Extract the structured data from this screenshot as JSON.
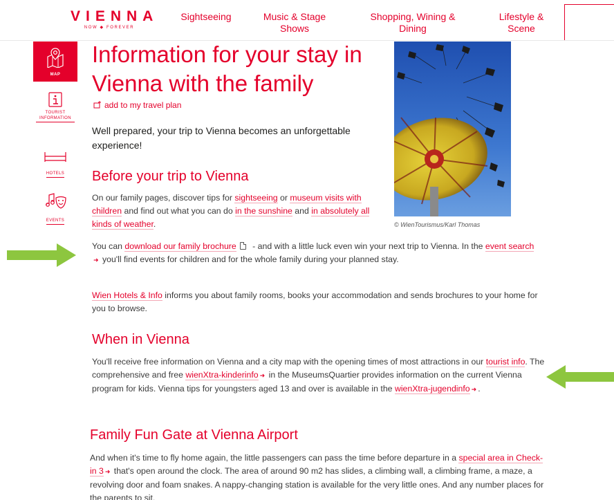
{
  "header": {
    "logo": {
      "word": "VIENNA",
      "sub": "NOW ◆ FOREVER"
    },
    "nav": [
      {
        "label": "Sightseeing"
      },
      {
        "label": "Music & Stage Shows"
      },
      {
        "label": "Shopping, Wining & Dining"
      },
      {
        "label": "Lifestyle & Scene"
      }
    ]
  },
  "rail": {
    "items": [
      {
        "label": "MAP",
        "icon": "map-icon"
      },
      {
        "label": "TOURIST INFORMATION",
        "icon": "info-icon"
      },
      {
        "label": "HOTELS",
        "icon": "bed-icon"
      },
      {
        "label": "EVENTS",
        "icon": "music-mask-icon"
      }
    ]
  },
  "main": {
    "title": "Information for your stay in Vienna with the family",
    "add_plan": "add to my travel plan",
    "lead": "Well prepared, your trip to Vienna becomes an unforgettable experience!",
    "before": {
      "heading": "Before your trip to Vienna",
      "p1": {
        "t1": "On our family pages, discover tips for ",
        "l1": "sightseeing",
        "t2": " or ",
        "l2": "museum visits with children",
        "t3": " and find out what you can do ",
        "l3": "in the sunshine",
        "t4": " and ",
        "l4": "in absolutely all kinds of weather",
        "t5": "."
      },
      "p2": {
        "t1": "You can ",
        "l1": "download our family brochure",
        "t2": " - and with a little luck even win your next trip to Vienna. In the ",
        "l2": "event search",
        "t3": " you'll find events for children and for the whole family during your planned stay."
      },
      "p3": {
        "l1": "Wien Hotels & Info",
        "t1": " informs you about family rooms, books your accommodation and sends brochures to your home for you to browse."
      }
    },
    "when": {
      "heading": "When in Vienna",
      "p1": {
        "t1": "You'll receive free information on Vienna and a city map with the opening times of most attractions in our ",
        "l1": "tourist info",
        "t2": ". The comprehensive and free ",
        "l2": "wienXtra-kinderinfo",
        "t3": " in the MuseumsQuartier provides information on the current Vienna program for kids. Vienna tips for youngsters aged 13 and over is available in the ",
        "l3": "wienXtra-jugendinfo",
        "t4": "."
      }
    },
    "airport": {
      "heading": "Family Fun Gate at Vienna Airport",
      "p1": {
        "t1": "And when it's time to fly home again, the little passengers can pass the time before departure in a ",
        "l1": "special area in Check-in 3",
        "t2": " that's open around the clock. The area of around 90 m2 has slides, a climbing wall, a climbing frame, a maze, a revolving door and foam snakes. A nappy-changing station is available for the very little ones. And any number places for the parents to sit."
      }
    },
    "photo_credit": "© WienTourismus/Karl Thomas"
  },
  "colors": {
    "brand": "#e4002b",
    "arrow": "#8dc63f",
    "text": "#3a3a3a"
  }
}
